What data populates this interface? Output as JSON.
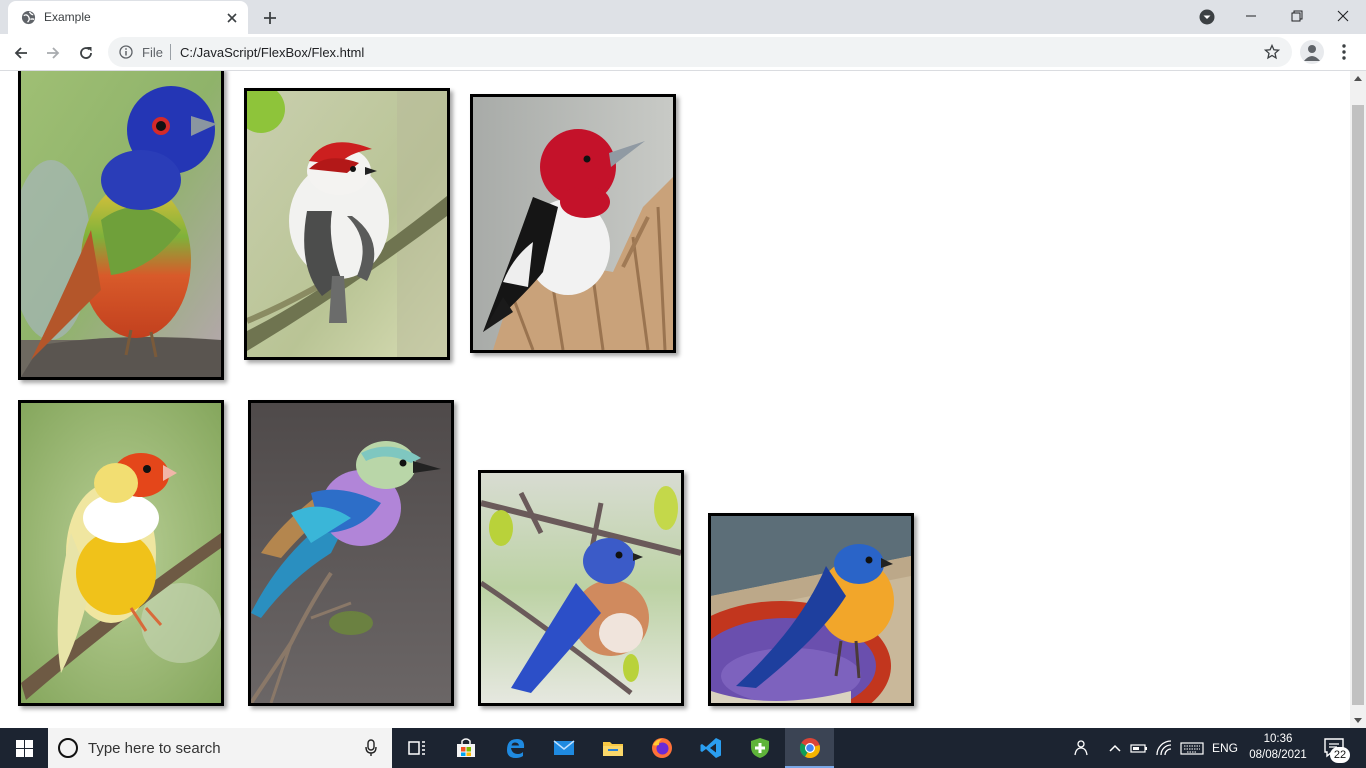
{
  "browser": {
    "tab": {
      "title": "Example"
    },
    "address": {
      "scheme_label": "File",
      "url": "C:/JavaScript/FlexBox/Flex.html"
    }
  },
  "page": {
    "photos": [
      {
        "subject": "painted bunting"
      },
      {
        "subject": "white bird with red crest"
      },
      {
        "subject": "red-headed woodpecker"
      },
      {
        "subject": "gouldian finch"
      },
      {
        "subject": "lilac-breasted roller"
      },
      {
        "subject": "eastern bluebird on branch"
      },
      {
        "subject": "bluebird at birdbath"
      }
    ]
  },
  "taskbar": {
    "search_placeholder": "Type here to search",
    "language": "ENG",
    "time": "10:36",
    "date": "08/08/2021",
    "notification_count": "22",
    "apps": [
      "task-view",
      "microsoft-store",
      "edge",
      "mail",
      "file-explorer",
      "firefox",
      "vscode",
      "security",
      "chrome"
    ]
  },
  "colors": {
    "tabstrip": "#dee1e6",
    "taskbar": "#1c2431",
    "photo_border": "#000000"
  }
}
